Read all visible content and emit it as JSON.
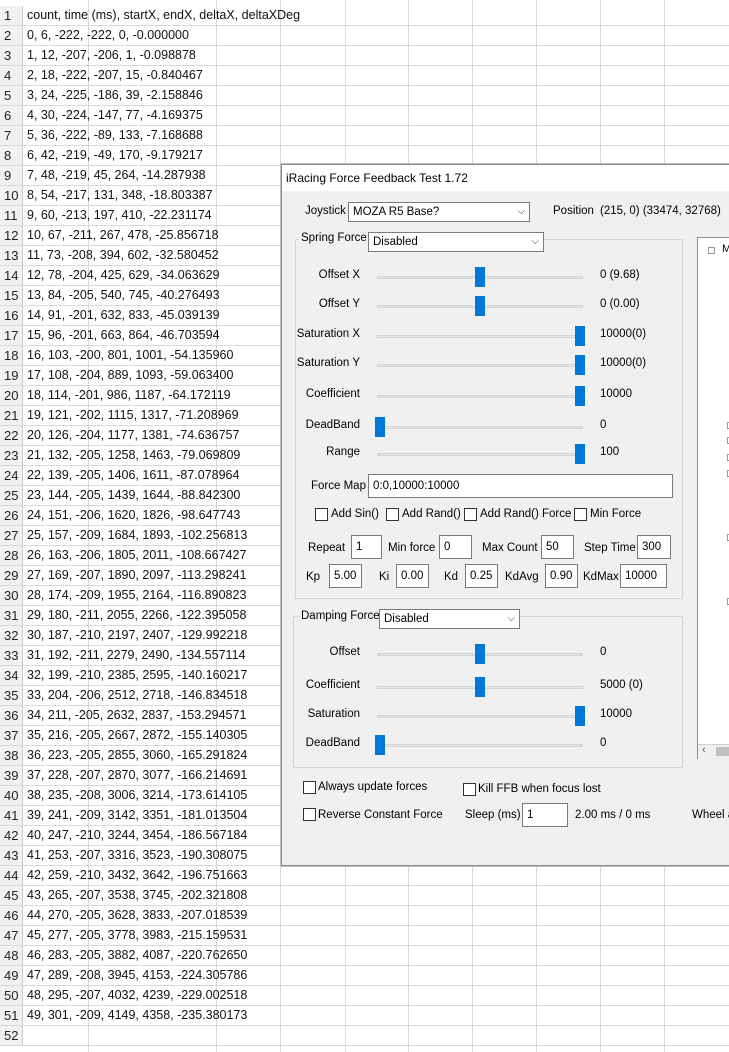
{
  "sheet": {
    "rows": [
      "count, time (ms), startX, endX, deltaX, deltaXDeg",
      "0, 6, -222, -222, 0, -0.000000",
      "1, 12, -207, -206, 1, -0.098878",
      "2, 18, -222, -207, 15, -0.840467",
      "3, 24, -225, -186, 39, -2.158846",
      "4, 30, -224, -147, 77, -4.169375",
      "5, 36, -222, -89, 133, -7.168688",
      "6, 42, -219, -49, 170, -9.179217",
      "7, 48, -219, 45, 264, -14.287938",
      "8, 54, -217, 131, 348, -18.803387",
      "9, 60, -213, 197, 410, -22.231174",
      "10, 67, -211, 267, 478, -25.856718",
      "11, 73, -208, 394, 602, -32.580452",
      "12, 78, -204, 425, 629, -34.063629",
      "13, 84, -205, 540, 745, -40.276493",
      "14, 91, -201, 632, 833, -45.039139",
      "15, 96, -201, 663, 864, -46.703594",
      "16, 103, -200, 801, 1001, -54.135960",
      "17, 108, -204, 889, 1093, -59.063400",
      "18, 114, -201, 986, 1187, -64.172119",
      "19, 121, -202, 1115, 1317, -71.208969",
      "20, 126, -204, 1177, 1381, -74.636757",
      "21, 132, -205, 1258, 1463, -79.069809",
      "22, 139, -205, 1406, 1611, -87.078964",
      "23, 144, -205, 1439, 1644, -88.842300",
      "24, 151, -206, 1620, 1826, -98.647743",
      "25, 157, -209, 1684, 1893, -102.256813",
      "26, 163, -206, 1805, 2011, -108.667427",
      "27, 169, -207, 1890, 2097, -113.298241",
      "28, 174, -209, 1955, 2164, -116.890823",
      "29, 180, -211, 2055, 2266, -122.395058",
      "30, 187, -210, 2197, 2407, -129.992218",
      "31, 192, -211, 2279, 2490, -134.557114",
      "32, 199, -210, 2385, 2595, -140.160217",
      "33, 204, -206, 2512, 2718, -146.834518",
      "34, 211, -205, 2632, 2837, -153.294571",
      "35, 216, -205, 2667, 2872, -155.140305",
      "36, 223, -205, 2855, 3060, -165.291824",
      "37, 228, -207, 2870, 3077, -166.214691",
      "38, 235, -208, 3006, 3214, -173.614105",
      "39, 241, -209, 3142, 3351, -181.013504",
      "40, 247, -210, 3244, 3454, -186.567184",
      "41, 253, -207, 3316, 3523, -190.308075",
      "42, 259, -210, 3432, 3642, -196.751663",
      "43, 265, -207, 3538, 3745, -202.321808",
      "44, 270, -205, 3628, 3833, -207.018539",
      "45, 277, -205, 3778, 3983, -215.159531",
      "46, 283, -205, 3882, 4087, -220.762650",
      "47, 289, -208, 3945, 4153, -224.305786",
      "48, 295, -207, 4032, 4239, -229.002518",
      "49, 301, -209, 4149, 4358, -235.380173",
      ""
    ]
  },
  "dialog": {
    "title": "iRacing Force Feedback Test 1.72",
    "joystick_label": "Joystick",
    "joystick_value": "MOZA R5 Base?",
    "position_label": "Position",
    "position_value": "(215, 0) (33474, 32768)",
    "spring": {
      "group_label": "Spring Force",
      "mode": "Disabled",
      "sliders": [
        {
          "label": "Offset X",
          "value": "0 (9.68)",
          "level": 0.5
        },
        {
          "label": "Offset Y",
          "value": "0 (0.00)",
          "level": 0.5
        },
        {
          "label": "Saturation X",
          "value": "10000(0)",
          "level": 1.0
        },
        {
          "label": "Saturation Y",
          "value": "10000(0)",
          "level": 1.0
        },
        {
          "label": "Coefficient",
          "value": "10000",
          "level": 1.0
        },
        {
          "label": "DeadBand",
          "value": "0",
          "level": 0.0
        },
        {
          "label": "Range",
          "value": "100",
          "level": 1.0
        }
      ],
      "force_map_label": "Force Map",
      "force_map_value": "0:0,10000:10000",
      "checkboxes": [
        "Add Sin()",
        "Add Rand()",
        "Add Rand() Force",
        "Min Force"
      ],
      "repeat_label": "Repeat",
      "repeat_value": "1",
      "min_force_label": "Min force",
      "min_force_value": "0",
      "max_count_label": "Max Count",
      "max_count_value": "50",
      "step_time_label": "Step Time",
      "step_time_value": "300",
      "kp_label": "Kp",
      "kp_value": "5.00",
      "ki_label": "Ki",
      "ki_value": "0.00",
      "kd_label": "Kd",
      "kd_value": "0.25",
      "kdavg_label": "KdAvg",
      "kdavg_value": "0.90",
      "kdmax_label": "KdMax",
      "kdmax_value": "10000"
    },
    "damping": {
      "group_label": "Damping Force",
      "mode": "Disabled",
      "sliders": [
        {
          "label": "Offset",
          "value": "0",
          "level": 0.5
        },
        {
          "label": "Coefficient",
          "value": "5000 (0)",
          "level": 0.5
        },
        {
          "label": "Saturation",
          "value": "10000",
          "level": 1.0
        },
        {
          "label": "DeadBand",
          "value": "0",
          "level": 0.0
        }
      ]
    },
    "always_update": "Always update forces",
    "kill_ffb": "Kill FFB when focus lost",
    "reverse_constant": "Reverse Constant Force",
    "sleep_label": "Sleep (ms)",
    "sleep_value": "1",
    "sleep_readout": "2.00 ms / 0 ms",
    "wheel_label": "Wheel a",
    "tree_root": "M"
  }
}
